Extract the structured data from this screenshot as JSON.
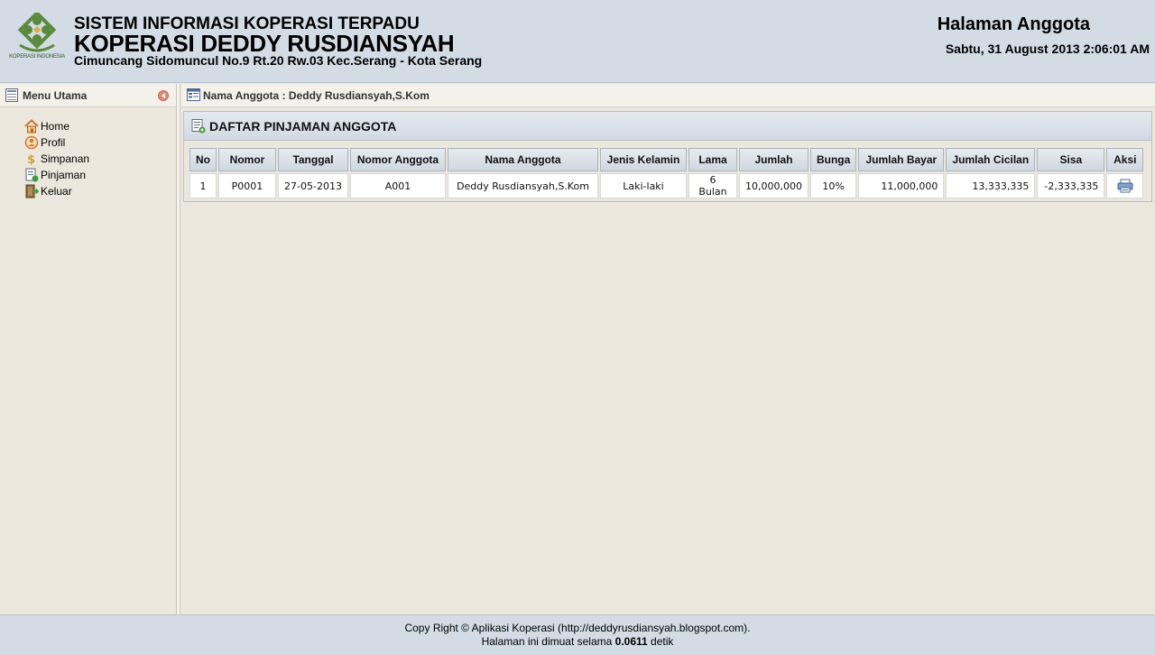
{
  "header": {
    "logo_caption": "KOPERASI INDONESIA",
    "line1": "SISTEM INFORMASI KOPERASI TERPADU",
    "line2": "KOPERASI DEDDY RUSDIANSYAH",
    "line3": "Cimuncang Sidomuncul No.9 Rt.20 Rw.03 Kec.Serang - Kota Serang",
    "page_title": "Halaman Anggota",
    "datetime": "Sabtu, 31 August 2013 2:06:01 AM"
  },
  "sidebar": {
    "title": "Menu Utama",
    "items": [
      {
        "label": "Home",
        "icon": "home-icon"
      },
      {
        "label": "Profil",
        "icon": "profile-icon"
      },
      {
        "label": "Simpanan",
        "icon": "money-icon"
      },
      {
        "label": "Pinjaman",
        "icon": "document-icon"
      },
      {
        "label": "Keluar",
        "icon": "exit-icon"
      }
    ]
  },
  "content": {
    "title": "Nama Anggota : Deddy Rusdiansyah,S.Kom",
    "panel_title": "DAFTAR PINJAMAN ANGGOTA",
    "columns": [
      "No",
      "Nomor",
      "Tanggal",
      "Nomor Anggota",
      "Nama Anggota",
      "Jenis Kelamin",
      "Lama",
      "Jumlah",
      "Bunga",
      "Jumlah Bayar",
      "Jumlah Cicilan",
      "Sisa",
      "Aksi"
    ],
    "rows": [
      {
        "no": "1",
        "nomor": "P0001",
        "tanggal": "27-05-2013",
        "nomor_anggota": "A001",
        "nama_anggota": "Deddy Rusdiansyah,S.Kom",
        "jenis_kelamin": "Laki-laki",
        "lama": "6 Bulan",
        "jumlah": "10,000,000",
        "bunga": "10%",
        "jumlah_bayar": "11,000,000",
        "jumlah_cicilan": "13,333,335",
        "sisa": "-2,333,335",
        "aksi_icon": "print-icon"
      }
    ]
  },
  "footer": {
    "copyright": "Copy Right © Aplikasi Koperasi (http://deddyrusdiansyah.blogspot.com).",
    "load_prefix": "Halaman ini dimuat selama",
    "load_time": "0.0611",
    "load_suffix": "detik"
  },
  "colors": {
    "header_bg": "#d3dbe4",
    "body_bg": "#ebe7dc",
    "logo_green": "#4a7a3a"
  }
}
